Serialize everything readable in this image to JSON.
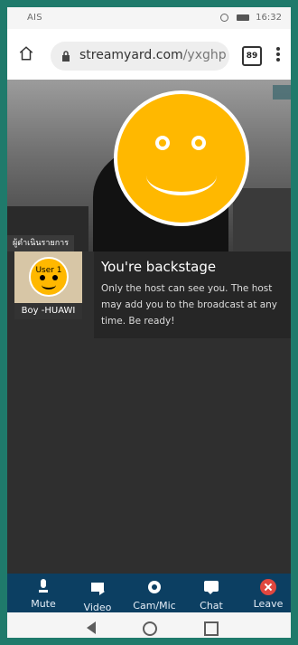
{
  "status_bar": {
    "left_text": "AIS",
    "time": "16:32"
  },
  "browser": {
    "url_domain": "streamyard.com",
    "url_path": "/yxghp",
    "tab_count": "89"
  },
  "stage": {
    "host_label": "ผู้ดำเนินรายการ"
  },
  "participant": {
    "avatar_text": "User 1",
    "name": "Boy -HUAWI"
  },
  "backstage": {
    "title": "You're backstage",
    "message": "Only the host can see you. The host may add you to the broadcast at any time. Be ready!"
  },
  "toolbar": {
    "items": [
      {
        "label": "Mute",
        "icon": "mic-icon"
      },
      {
        "label": "Video",
        "icon": "video-camera-icon"
      },
      {
        "label": "Cam/Mic",
        "icon": "gear-icon"
      },
      {
        "label": "Chat",
        "icon": "chat-icon"
      },
      {
        "label": "Leave",
        "icon": "close-circle-icon"
      }
    ]
  },
  "nav": {
    "back_icon": "back-triangle-icon",
    "home_icon": "home-circle-icon",
    "recents_icon": "recents-square-icon"
  }
}
